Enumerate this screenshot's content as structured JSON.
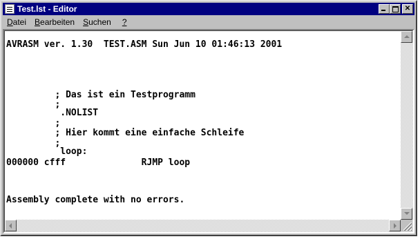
{
  "window": {
    "title": "Test.lst - Editor"
  },
  "menu": [
    {
      "pre": "",
      "ul": "D",
      "post": "atei"
    },
    {
      "pre": "",
      "ul": "B",
      "post": "earbeiten"
    },
    {
      "pre": "",
      "ul": "S",
      "post": "uchen"
    },
    {
      "pre": "",
      "ul": "?",
      "post": ""
    }
  ],
  "document": {
    "lines": [
      "AVRASM ver. 1.30  TEST.ASM Sun Jun 10 01:46:13 2001",
      "",
      "",
      "         ; Das ist ein Testprogramm",
      "         ;",
      "          .NOLIST",
      "         ;",
      "         ; Hier kommt eine einfache Schleife",
      "         ;",
      "          loop:",
      "000000 cfff              RJMP loop",
      "",
      "",
      "Assembly complete with no errors."
    ]
  },
  "icons": {
    "app": "notepad-icon",
    "minimize": "minimize-icon",
    "maximize": "maximize-icon",
    "close": "close-icon"
  }
}
